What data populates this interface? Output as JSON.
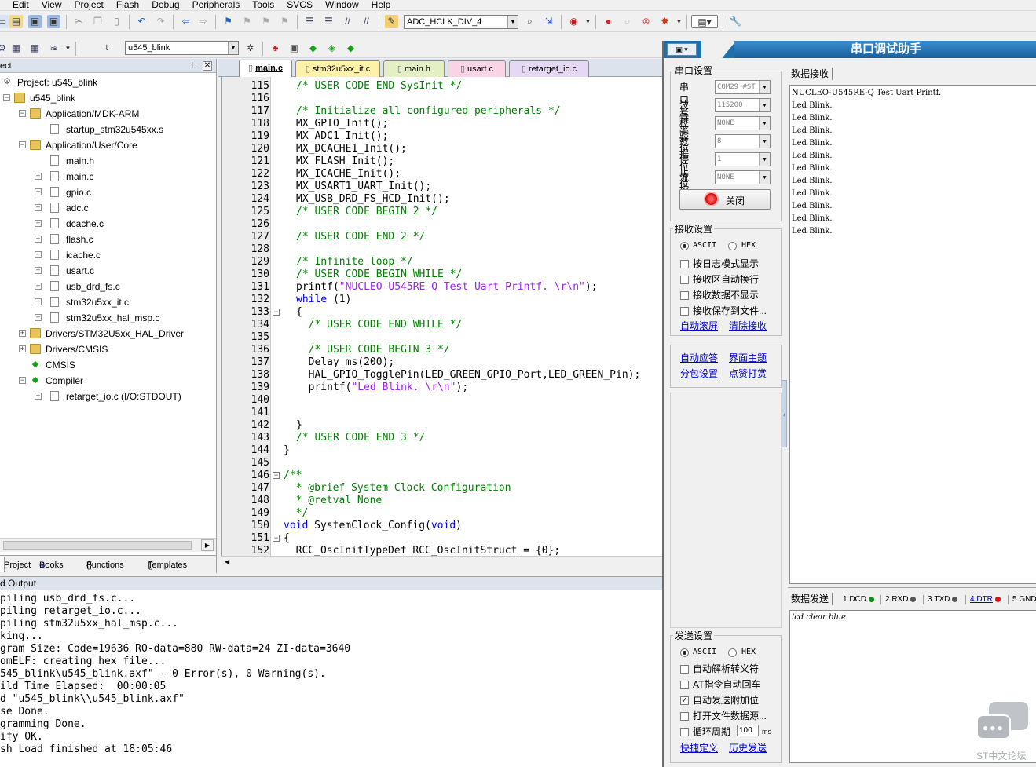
{
  "menu": [
    "Edit",
    "View",
    "Project",
    "Flash",
    "Debug",
    "Peripherals",
    "Tools",
    "SVCS",
    "Window",
    "Help"
  ],
  "toolbar": {
    "define_combo": "ADC_HCLK_DIV_4",
    "target_combo": "u545_blink"
  },
  "project": {
    "header": "ect",
    "tree": [
      {
        "label": "Project: u545_blink",
        "level": 0,
        "type": "project",
        "expander": ""
      },
      {
        "label": "u545_blink",
        "level": 1,
        "type": "folder",
        "expander": "−"
      },
      {
        "label": "Application/MDK-ARM",
        "level": 2,
        "type": "folder",
        "expander": "−"
      },
      {
        "label": "startup_stm32u545xx.s",
        "level": 3,
        "type": "file",
        "expander": ""
      },
      {
        "label": "Application/User/Core",
        "level": 2,
        "type": "folder",
        "expander": "−"
      },
      {
        "label": "main.h",
        "level": 3,
        "type": "file",
        "expander": ""
      },
      {
        "label": "main.c",
        "level": 3,
        "type": "file",
        "expander": "+"
      },
      {
        "label": "gpio.c",
        "level": 3,
        "type": "file",
        "expander": "+"
      },
      {
        "label": "adc.c",
        "level": 3,
        "type": "file",
        "expander": "+"
      },
      {
        "label": "dcache.c",
        "level": 3,
        "type": "file",
        "expander": "+"
      },
      {
        "label": "flash.c",
        "level": 3,
        "type": "file",
        "expander": "+"
      },
      {
        "label": "icache.c",
        "level": 3,
        "type": "file",
        "expander": "+"
      },
      {
        "label": "usart.c",
        "level": 3,
        "type": "file",
        "expander": "+"
      },
      {
        "label": "usb_drd_fs.c",
        "level": 3,
        "type": "file",
        "expander": "+"
      },
      {
        "label": "stm32u5xx_it.c",
        "level": 3,
        "type": "file",
        "expander": "+"
      },
      {
        "label": "stm32u5xx_hal_msp.c",
        "level": 3,
        "type": "file",
        "expander": "+"
      },
      {
        "label": "Drivers/STM32U5xx_HAL_Driver",
        "level": 2,
        "type": "folder",
        "expander": "+"
      },
      {
        "label": "Drivers/CMSIS",
        "level": 2,
        "type": "folder",
        "expander": "+"
      },
      {
        "label": "CMSIS",
        "level": 2,
        "type": "component",
        "expander": ""
      },
      {
        "label": "Compiler",
        "level": 2,
        "type": "component",
        "expander": "−"
      },
      {
        "label": "retarget_io.c (I/O:STDOUT)",
        "level": 3,
        "type": "file",
        "expander": "+"
      }
    ],
    "tabs": [
      "Project",
      "Books",
      "Functions",
      "Templates"
    ]
  },
  "editor": {
    "tabs": [
      {
        "label": "main.c",
        "color": "#ffffff",
        "active": true
      },
      {
        "label": "stm32u5xx_it.c",
        "color": "#fff2a8",
        "active": false
      },
      {
        "label": "main.h",
        "color": "#e4f0c4",
        "active": false
      },
      {
        "label": "usart.c",
        "color": "#f9d4e4",
        "active": false
      },
      {
        "label": "retarget_io.c",
        "color": "#e4d8f4",
        "active": false
      }
    ],
    "lines": [
      {
        "n": "115",
        "fold": "",
        "html": "<span class=\"cm\">/* USER CODE END SysInit */</span>",
        "indent": 0
      },
      {
        "n": "116",
        "fold": "",
        "html": "",
        "indent": 0
      },
      {
        "n": "117",
        "fold": "",
        "html": "<span class=\"cm\">/* Initialize all configured peripherals */</span>",
        "indent": 0
      },
      {
        "n": "118",
        "fold": "",
        "html": "MX_GPIO_Init();",
        "indent": 0
      },
      {
        "n": "119",
        "fold": "",
        "html": "MX_ADC1_Init();",
        "indent": 0
      },
      {
        "n": "120",
        "fold": "",
        "html": "MX_DCACHE1_Init();",
        "indent": 0
      },
      {
        "n": "121",
        "fold": "",
        "html": "MX_FLASH_Init();",
        "indent": 0
      },
      {
        "n": "122",
        "fold": "",
        "html": "MX_ICACHE_Init();",
        "indent": 0
      },
      {
        "n": "123",
        "fold": "",
        "html": "MX_USART1_UART_Init();",
        "indent": 0
      },
      {
        "n": "124",
        "fold": "",
        "html": "MX_USB_DRD_FS_HCD_Init();",
        "indent": 0
      },
      {
        "n": "125",
        "fold": "",
        "html": "<span class=\"cm\">/* USER CODE BEGIN 2 */</span>",
        "indent": 0
      },
      {
        "n": "126",
        "fold": "",
        "html": "",
        "indent": 0
      },
      {
        "n": "127",
        "fold": "",
        "html": "<span class=\"cm\">/* USER CODE END 2 */</span>",
        "indent": 0
      },
      {
        "n": "128",
        "fold": "",
        "html": "",
        "indent": 0
      },
      {
        "n": "129",
        "fold": "",
        "html": "<span class=\"cm\">/* Infinite loop */</span>",
        "indent": 0
      },
      {
        "n": "130",
        "fold": "",
        "html": "<span class=\"cm\">/* USER CODE BEGIN WHILE */</span>",
        "indent": 0
      },
      {
        "n": "131",
        "fold": "",
        "html": "printf(<span class=\"st\">\"NUCLEO-U545RE-Q Test Uart Printf. \\r\\n\"</span>);",
        "indent": 0
      },
      {
        "n": "132",
        "fold": "",
        "html": "<span class=\"kw\">while</span> (1)",
        "indent": 0
      },
      {
        "n": "133",
        "fold": "−",
        "html": "{",
        "indent": 0
      },
      {
        "n": "134",
        "fold": "",
        "html": "  <span class=\"cm\">/* USER CODE END WHILE */</span>",
        "indent": 0
      },
      {
        "n": "135",
        "fold": "",
        "html": "",
        "indent": 0
      },
      {
        "n": "136",
        "fold": "",
        "html": "  <span class=\"cm\">/* USER CODE BEGIN 3 */</span>",
        "indent": 0
      },
      {
        "n": "137",
        "fold": "",
        "html": "  Delay_ms(200);",
        "indent": 0
      },
      {
        "n": "138",
        "fold": "",
        "html": "  HAL_GPIO_TogglePin(LED_GREEN_GPIO_Port,LED_GREEN_Pin);",
        "indent": 0
      },
      {
        "n": "139",
        "fold": "",
        "html": "  printf(<span class=\"st\">\"Led Blink. \\r\\n\"</span>);",
        "indent": 0
      },
      {
        "n": "140",
        "fold": "",
        "html": "",
        "indent": 0
      },
      {
        "n": "141",
        "fold": "",
        "html": "",
        "indent": 0
      },
      {
        "n": "142",
        "fold": "",
        "html": "}",
        "indent": 0
      },
      {
        "n": "143",
        "fold": "",
        "html": "<span class=\"cm\">/* USER CODE END 3 */</span>",
        "indent": 0
      },
      {
        "n": "144",
        "fold": "",
        "html": "}",
        "indent": -1
      },
      {
        "n": "145",
        "fold": "",
        "html": "",
        "indent": 0
      },
      {
        "n": "146",
        "fold": "−",
        "html": "<span class=\"cm\">/**</span>",
        "indent": -1
      },
      {
        "n": "147",
        "fold": "",
        "html": "<span class=\"cm\">  * @brief System Clock Configuration</span>",
        "indent": -1
      },
      {
        "n": "148",
        "fold": "",
        "html": "<span class=\"cm\">  * @retval None</span>",
        "indent": -1
      },
      {
        "n": "149",
        "fold": "",
        "html": "<span class=\"cm\">  */</span>",
        "indent": -1
      },
      {
        "n": "150",
        "fold": "",
        "html": "<span class=\"kw\">void</span> SystemClock_Config(<span class=\"kw\">void</span>)",
        "indent": -1
      },
      {
        "n": "151",
        "fold": "−",
        "html": "{",
        "indent": -1
      },
      {
        "n": "152",
        "fold": "",
        "html": "  RCC_OscInitTypeDef RCC_OscInitStruct = {0};",
        "indent": -1
      }
    ]
  },
  "build": {
    "header": "d Output",
    "lines": [
      "piling usb_drd_fs.c...",
      "piling retarget_io.c...",
      "piling stm32u5xx_hal_msp.c...",
      "king...",
      "gram Size: Code=19636 RO-data=880 RW-data=24 ZI-data=3640",
      "omELF: creating hex file...",
      "545_blink\\u545_blink.axf\" - 0 Error(s), 0 Warning(s).",
      "ild Time Elapsed:  00:00:05",
      "d \"u545_blink\\\\u545_blink.axf\"",
      "se Done.",
      "gramming Done.",
      "ify OK.",
      "sh Load finished at 18:05:46"
    ]
  },
  "serial": {
    "title": "串口调试助手",
    "port_group": "串口设置",
    "fields": [
      {
        "label": "串口号",
        "value": "COM29 #ST"
      },
      {
        "label": "波特率",
        "value": "115200"
      },
      {
        "label": "校验位",
        "value": "NONE"
      },
      {
        "label": "数据位",
        "value": "8"
      },
      {
        "label": "停止位",
        "value": "1"
      },
      {
        "label": "流控制",
        "value": "NONE"
      }
    ],
    "close_btn": "关闭",
    "rx_group": "接收设置",
    "rx_ascii": "ASCII",
    "rx_hex": "HEX",
    "rx_options": [
      "按日志模式显示",
      "接收区自动换行",
      "接收数据不显示",
      "接收保存到文件..."
    ],
    "rx_links": [
      "自动滚屏",
      "清除接收"
    ],
    "misc_links": [
      "自动应答",
      "界面主题",
      "分包设置",
      "点赞打赏"
    ],
    "rx_label": "数据接收",
    "rx_lines": [
      "NUCLEO-U545RE-Q Test Uart Printf.",
      "Led Blink.",
      "Led Blink.",
      "Led Blink.",
      "Led Blink.",
      "Led Blink.",
      "Led Blink.",
      "Led Blink.",
      "Led Blink.",
      "Led Blink.",
      "Led Blink.",
      "Led Blink."
    ],
    "tx_label": "数据发送",
    "signals": [
      {
        "label": "1.DCD",
        "color": "#1a8a1a"
      },
      {
        "label": "2.RXD",
        "color": "#555555"
      },
      {
        "label": "3.TXD",
        "color": "#555555"
      },
      {
        "label": "4.DTR",
        "color": "#e01010"
      },
      {
        "label": "5.GND",
        "color": "#1a8a1a"
      }
    ],
    "tx_text": "lcd clear blue",
    "tx_group": "发送设置",
    "tx_ascii": "ASCII",
    "tx_hex": "HEX",
    "tx_options": [
      {
        "label": "自动解析转义符",
        "checked": false
      },
      {
        "label": "AT指令自动回车",
        "checked": false
      },
      {
        "label": "自动发送附加位",
        "checked": true
      },
      {
        "label": "打开文件数据源...",
        "checked": false
      },
      {
        "label": "循环周期",
        "checked": false
      }
    ],
    "period_value": "100",
    "period_unit": "ms",
    "tx_links": [
      "快捷定义",
      "历史发送"
    ],
    "watermark": "ST中文论坛"
  }
}
